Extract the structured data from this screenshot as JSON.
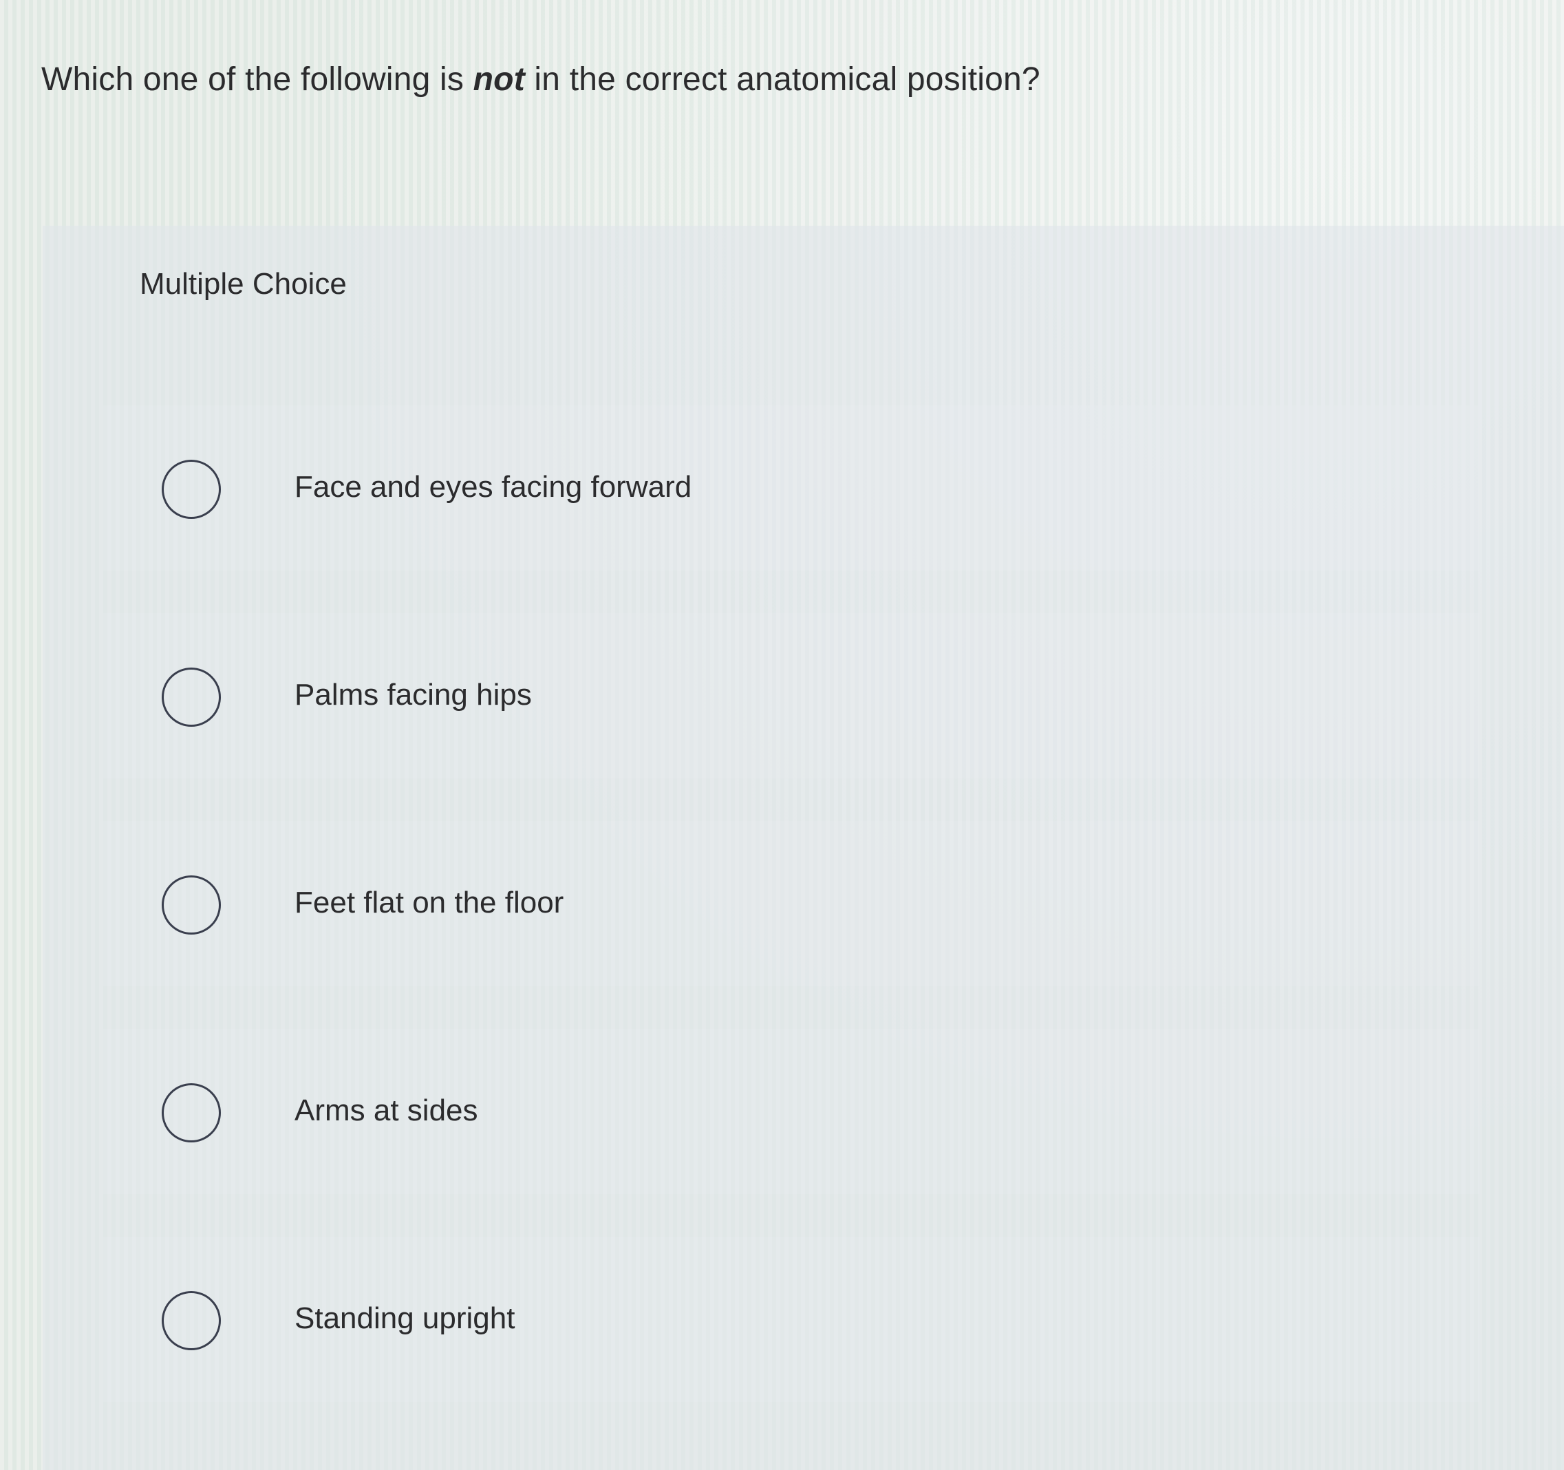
{
  "question": {
    "before": "Which one of the following is ",
    "emphasis": "not",
    "after": " in the correct anatomical position?"
  },
  "panel": {
    "label": "Multiple Choice"
  },
  "options": [
    {
      "label": "Face and eyes facing forward",
      "selected": false
    },
    {
      "label": "Palms facing hips",
      "selected": false
    },
    {
      "label": "Feet flat on the floor",
      "selected": false
    },
    {
      "label": "Arms at sides",
      "selected": false
    },
    {
      "label": "Standing upright",
      "selected": false
    }
  ],
  "colors": {
    "text": "#2b2b2d",
    "radio_border": "#3a3f4e",
    "panel_background": "#e1e5ea"
  }
}
